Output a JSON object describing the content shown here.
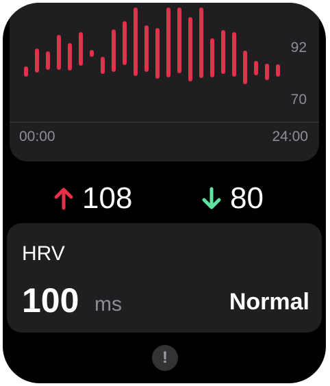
{
  "chart": {
    "y_top_label": "92",
    "y_bottom_label": "70",
    "x_start_label": "00:00",
    "x_end_label": "24:00",
    "bar_color": "#e5304a"
  },
  "stats": {
    "max_value": "108",
    "min_value": "80",
    "max_arrow_color": "#e5304a",
    "min_arrow_color": "#5fe3a1"
  },
  "hrv": {
    "title": "HRV",
    "value": "100",
    "unit": "ms",
    "status": "Normal"
  },
  "icons": {
    "info": "exclamation-icon"
  }
}
